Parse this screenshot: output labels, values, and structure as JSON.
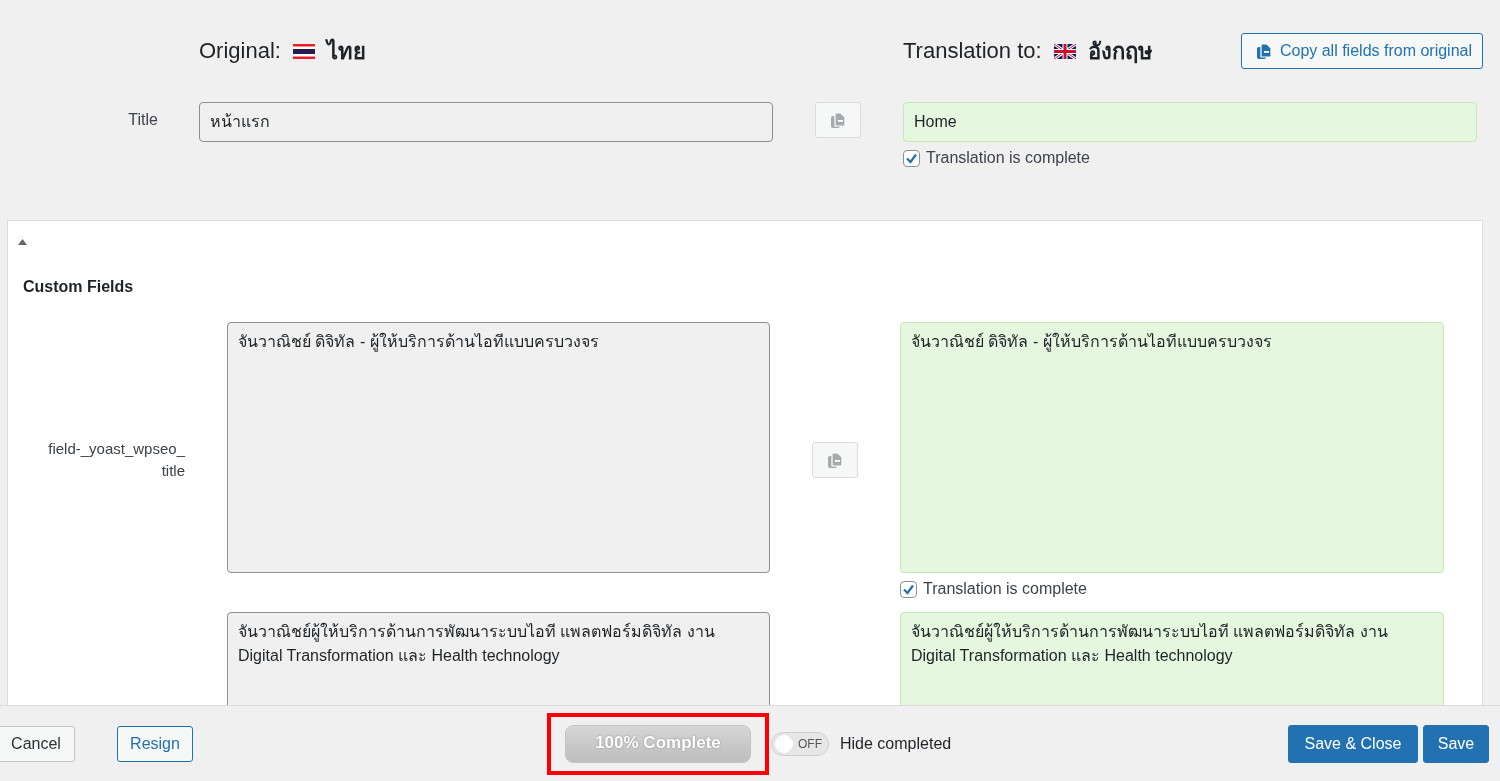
{
  "header": {
    "original_label": "Original:",
    "original_language": "ไทย",
    "translation_label": "Translation to:",
    "translation_language": "อังกฤษ",
    "copy_all_button": "Copy all fields from original"
  },
  "title_row": {
    "label": "Title",
    "original": "หน้าแรก",
    "translation": "Home",
    "complete": {
      "label": "Translation is complete",
      "checked": true
    }
  },
  "custom_fields": {
    "heading": "Custom Fields",
    "expanded": true,
    "rows": [
      {
        "label": "field-_yoast_wpseo_title",
        "original": "จันวาณิชย์ ดิจิทัล - ผู้ให้บริการด้านไอทีแบบครบวงจร",
        "translation": "จันวาณิชย์ ดิจิทัล - ผู้ให้บริการด้านไอทีแบบครบวงจร",
        "complete": {
          "label": "Translation is complete",
          "checked": true
        }
      },
      {
        "original": "จันวาณิชย์ผู้ให้บริการด้านการพัฒนาระบบไอที แพลตฟอร์มดิจิทัล งาน Digital Transformation และ Health technology",
        "translation": "จันวาณิชย์ผู้ให้บริการด้านการพัฒนาระบบไอที แพลตฟอร์มดิจิทัล งาน Digital Transformation และ Health technology"
      }
    ]
  },
  "footer": {
    "cancel": "Cancel",
    "resign": "Resign",
    "progress": {
      "label": "100% Complete",
      "level": 1,
      "highlighted": true
    },
    "toggle": {
      "label": "OFF",
      "on": false
    },
    "toggle_caption": "Hide completed",
    "buttons": [
      "Save & Close",
      "Save"
    ]
  }
}
